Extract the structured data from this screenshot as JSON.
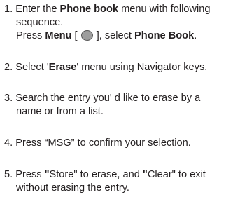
{
  "steps": [
    {
      "lead": "1. Enter the ",
      "bold": "Phone book",
      "tail": " menu with following",
      "line2": "sequence.",
      "line3": {
        "press": "Press ",
        "menu": "Menu",
        "bracket_open": " [ ",
        "bracket_close": " ], select ",
        "target": "Phone Book",
        "end": "."
      }
    },
    {
      "lead": "2. Select '",
      "bold": "Erase",
      "tail": "' menu using Navigator keys."
    },
    {
      "line1": "3. Search the entry you' d like to erase by a",
      "line2": "name or from a list."
    },
    {
      "line1": "4. Press “MSG” to confirm your selection."
    },
    {
      "lead": "5. Press ",
      "q1": "\"",
      "store": "Store\" to erase, and ",
      "q2": "\"",
      "clear": "Clear\" to exit",
      "line2": "without erasing the entry."
    }
  ],
  "icons": {
    "menu_key": "round-menu-key-icon"
  }
}
